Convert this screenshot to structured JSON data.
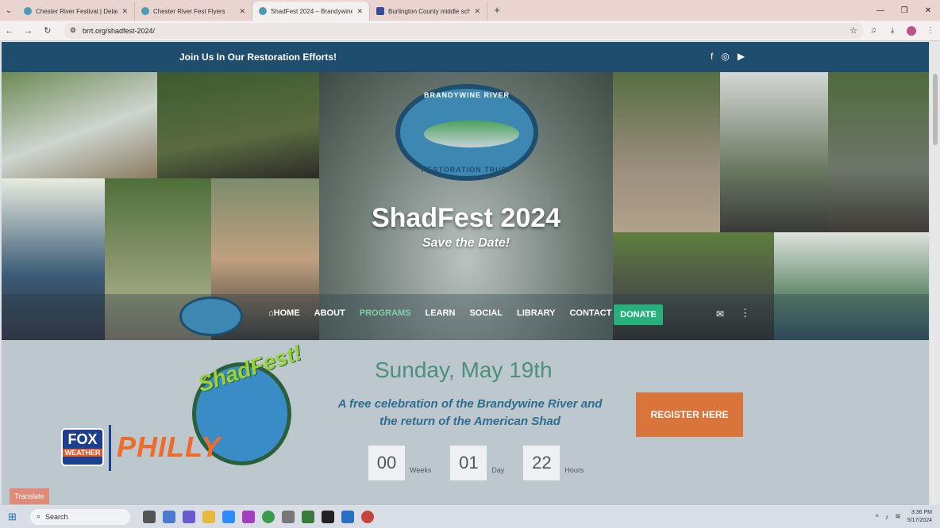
{
  "browser": {
    "tabs": [
      {
        "title": "Chester River Festival | Delawa",
        "active": false
      },
      {
        "title": "Chester River Fest Flyers",
        "active": false
      },
      {
        "title": "ShadFest 2024 – Brandywine Ri",
        "active": true
      },
      {
        "title": "Burlington County middle scho",
        "active": false
      }
    ],
    "url": "brrt.org/shadfest-2024/"
  },
  "site": {
    "topbar_text": "Join Us In Our Restoration Efforts!",
    "social_icons": [
      "facebook-icon",
      "instagram-icon",
      "youtube-icon"
    ],
    "logo_top": "BRANDYWINE RIVER",
    "logo_bottom": "RESTORATION TRUST",
    "hero_title": "ShadFest 2024",
    "hero_subtitle": "Save the Date!",
    "nav": [
      "HOME",
      "ABOUT",
      "PROGRAMS",
      "LEARN",
      "SOCIAL",
      "LIBRARY",
      "CONTACT"
    ],
    "nav_active": "PROGRAMS",
    "donate": "DONATE",
    "event_date": "Sunday, May 19th",
    "description": "A free celebration of the Brandywine River and the return of the American Shad",
    "register": "REGISTER HERE",
    "countdown": [
      {
        "value": "00",
        "label": "Weeks"
      },
      {
        "value": "01",
        "label": "Day"
      },
      {
        "value": "22",
        "label": "Hours"
      }
    ],
    "shadfest_word": "ShadFest!",
    "translate": "Translate"
  },
  "overlay": {
    "fox_top": "FOX",
    "fox_bottom": "WEATHER",
    "philly": "PHILLY"
  },
  "taskbar": {
    "search": "Search",
    "time": "3:36 PM",
    "date": "5/17/2024"
  }
}
